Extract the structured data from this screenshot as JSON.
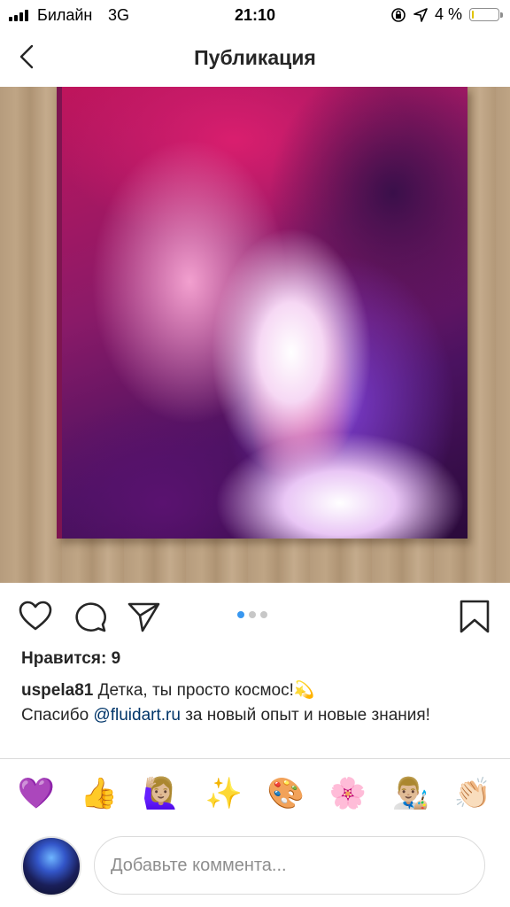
{
  "status_bar": {
    "carrier": "Билайн",
    "network": "3G",
    "time": "21:10",
    "battery_percent": "4 %",
    "battery_level": 0.04,
    "icons": [
      "lock-rotation-icon",
      "location-arrow-icon"
    ]
  },
  "nav": {
    "title": "Публикация",
    "back_icon": "chevron-left-icon"
  },
  "post": {
    "image_count": 3,
    "active_image_index": 0,
    "likes_text": "Нравится: 9",
    "caption": {
      "username": "uspela81",
      "text_part1": " Детка, ты просто космос!",
      "emoji_sparkle": "💫",
      "text_part2": "Спасибо ",
      "mention": "@fluidart.ru",
      "text_part3": " за новый опыт и новые знания!"
    }
  },
  "actions": {
    "like_icon": "heart-icon",
    "comment_icon": "comment-bubble-icon",
    "share_icon": "paper-plane-icon",
    "save_icon": "bookmark-icon"
  },
  "emoji_reactions": [
    "💜",
    "👍",
    "🙋🏼‍♀️",
    "✨",
    "🎨",
    "🌸",
    "👨🏼‍🎨",
    "👏🏻"
  ],
  "comment": {
    "placeholder": "Добавьте коммента..."
  },
  "colors": {
    "accent_blue": "#3897f0",
    "mention_blue": "#003569",
    "text": "#262626",
    "muted": "#8e8e8e"
  }
}
